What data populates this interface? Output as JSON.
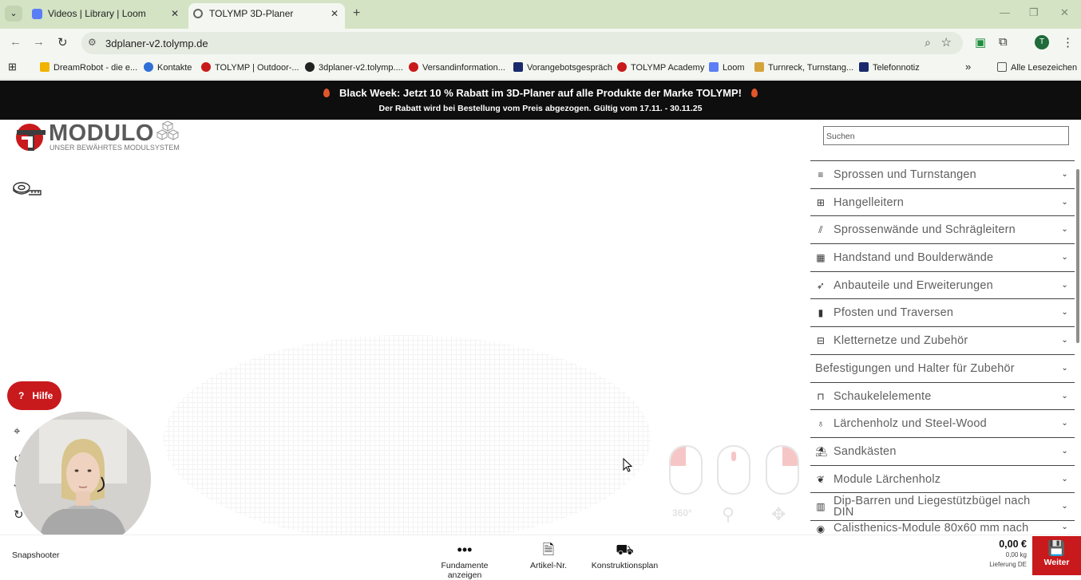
{
  "browser": {
    "tabs": [
      {
        "title": "Videos | Library | Loom",
        "active": false
      },
      {
        "title": "TOLYMP 3D-Planer",
        "active": true
      }
    ],
    "url": "3dplaner-v2.tolymp.de",
    "profile_initial": "T",
    "bookmarks": [
      "DreamRobot - die e...",
      "Kontakte",
      "TOLYMP | Outdoor-...",
      "3dplaner-v2.tolymp....",
      "Versandinformation...",
      "Vorangebotsgespräch",
      "TOLYMP Academy",
      "Loom",
      "Turnreck, Turnstang...",
      "Telefonnotiz"
    ],
    "all_bookmarks": "Alle Lesezeichen"
  },
  "banner": {
    "line1": "Black Week: Jetzt 10 % Rabatt im 3D-Planer auf alle Produkte der Marke TOLYMP!",
    "line2": "Der Rabatt wird bei Bestellung vom Preis abgezogen. Gültig vom 17.11. - 30.11.25"
  },
  "logo": {
    "word": "MODULO",
    "tagline": "UNSER BEWÄHRTES MODULSYSTEM"
  },
  "canvas": {
    "help_label": "Hilfe",
    "help_icon": "?",
    "hint_labels": [
      "360°"
    ]
  },
  "panel": {
    "search_placeholder": "Suchen",
    "categories": [
      {
        "label": "Sprossen und Turnstangen",
        "icon": "filter-lines-icon"
      },
      {
        "label": "Hangelleitern",
        "icon": "ladder-icon"
      },
      {
        "label": "Sprossenwände und Schrägleitern",
        "icon": "slant-ladder-icon"
      },
      {
        "label": "Handstand und Boulderwände",
        "icon": "grid-wall-icon"
      },
      {
        "label": "Anbauteile und Erweiterungen",
        "icon": "rocket-icon"
      },
      {
        "label": "Pfosten und Traversen",
        "icon": "bar-chart-icon"
      },
      {
        "label": "Kletternetze und Zubehör",
        "icon": "net-icon"
      },
      {
        "label": "Befestigungen und Halter für Zubehör",
        "icon": ""
      },
      {
        "label": "Schaukelelemente",
        "icon": "swing-icon"
      },
      {
        "label": "Lärchenholz und Steel-Wood",
        "icon": "tree-icon"
      },
      {
        "label": "Sandkästen",
        "icon": "sandbox-icon"
      },
      {
        "label": "Module Lärchenholz",
        "icon": "leaf-icon"
      },
      {
        "label": "Dip-Barren und Liegestützbügel nach DIN",
        "icon": "dip-bar-icon"
      },
      {
        "label": "Calisthenics-Module 80x60 mm nach",
        "icon": "eye-icon"
      }
    ]
  },
  "bottom": {
    "snapshooter": "Snapshooter",
    "fundamente": "Fundamente anzeigen",
    "artikel": "Artikel-Nr.",
    "konstruktion": "Konstruktionsplan",
    "price": "0,00 €",
    "weight": "0,00 kg",
    "delivery": "Lieferung DE",
    "next": "Weiter"
  },
  "colors": {
    "accent_red": "#c8191c",
    "banner_bg": "#0e0e0e",
    "tabbar_bg": "#d3e3c4"
  }
}
